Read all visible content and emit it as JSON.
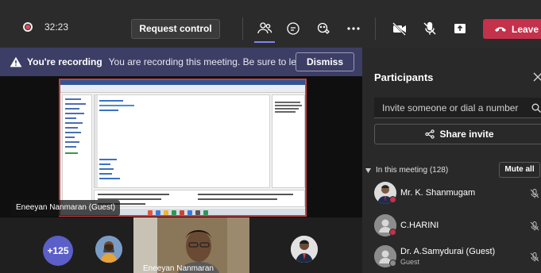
{
  "toolbar": {
    "timer": "32:23",
    "request_control_label": "Request control",
    "leave_label": "Leave",
    "icons": [
      "participants-icon",
      "chat-icon",
      "reactions-icon",
      "more-icon",
      "camera-off-icon",
      "mic-off-icon",
      "share-icon",
      "phone-icon"
    ]
  },
  "banner": {
    "title": "You're recording",
    "text": "You are recording this meeting. Be sure to let ...",
    "dismiss_label": "Dismiss"
  },
  "stage": {
    "presenter_name": "Eneeyan Nanmaran (Guest)"
  },
  "gallery": {
    "more_count": "+125",
    "tile_name": "Eneeyan Nanmaran"
  },
  "panel": {
    "title": "Participants",
    "invite_placeholder": "Invite someone or dial a number",
    "share_invite_label": "Share invite",
    "section_label": "In this meeting (128)",
    "mute_all_label": "Mute all",
    "participants": [
      {
        "name": "Mr. K. Shanmugam",
        "sub": ""
      },
      {
        "name": "C.HARINI",
        "sub": ""
      },
      {
        "name": "Dr. A.Samydurai (Guest)",
        "sub": "Guest"
      }
    ]
  },
  "colors": {
    "accent": "#5b5fc7",
    "leave": "#c4314b",
    "banner": "#3d3e66",
    "recording": "#e0475b"
  }
}
